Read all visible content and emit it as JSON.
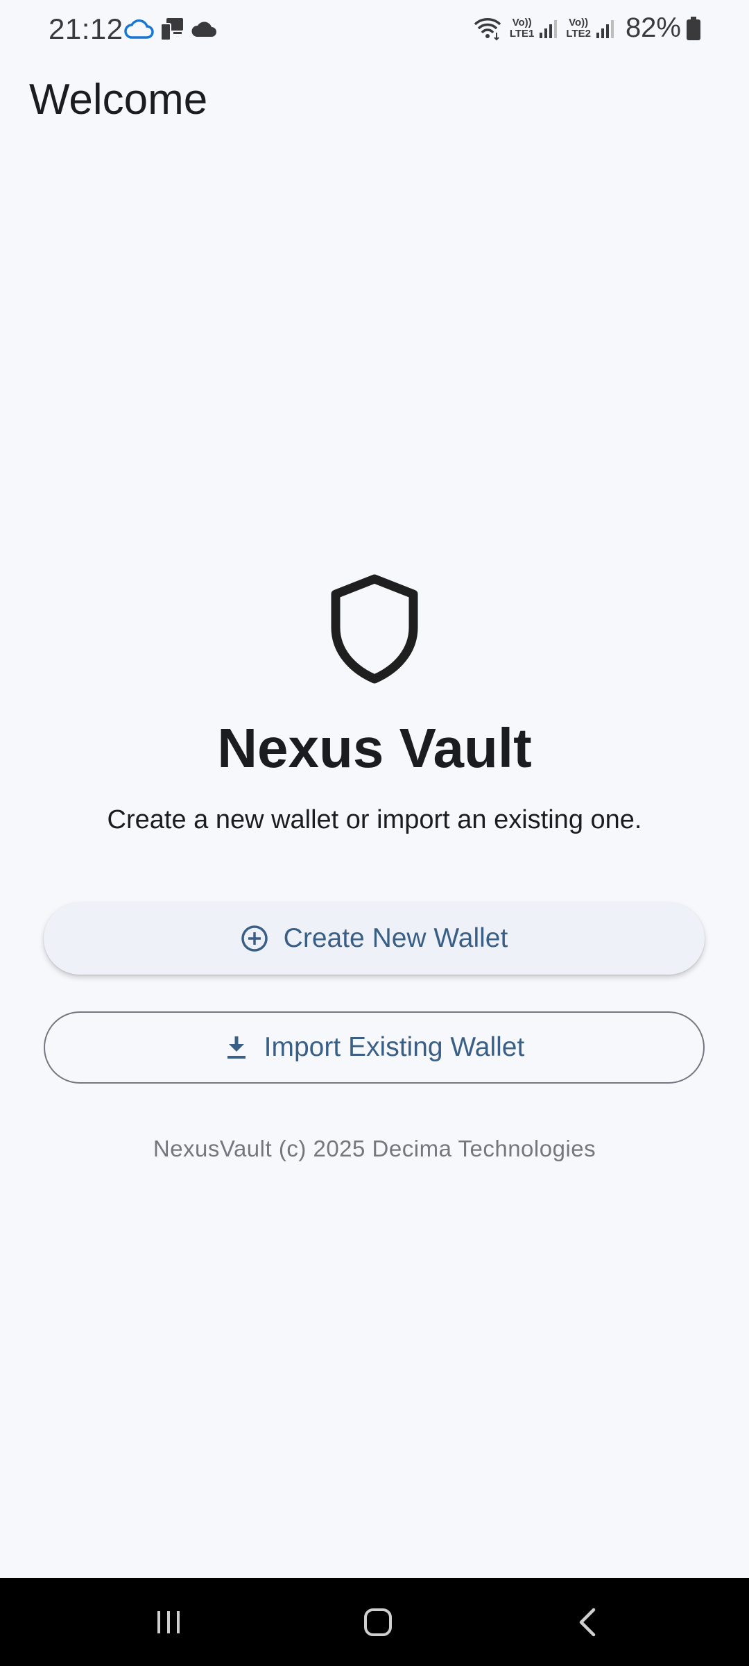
{
  "status_bar": {
    "time": "21:12",
    "left_icons": [
      "cloud-icon",
      "device-icon",
      "cloud-filled-icon"
    ],
    "wifi": "wifi-icon",
    "sim1_top": "Vo))",
    "sim1_bottom": "LTE1",
    "sim2_top": "Vo))",
    "sim2_bottom": "LTE2",
    "battery": "82%",
    "accent": "#1976d2"
  },
  "header": {
    "title": "Welcome"
  },
  "main": {
    "icon": "shield-icon",
    "app_name": "Nexus Vault",
    "subtitle": "Create a new wallet or import an existing one.",
    "create_button": {
      "icon": "add-circle-icon",
      "label": "Create New Wallet"
    },
    "import_button": {
      "icon": "download-icon",
      "label": "Import Existing Wallet"
    },
    "footer": "NexusVault (c) 2025 Decima Technologies"
  },
  "colors": {
    "background": "#f6f8fc",
    "button_text": "#3a5f86",
    "outline": "#73777f"
  },
  "nav_bar": {
    "recents": "recents-icon",
    "home": "home-icon",
    "back": "back-icon"
  }
}
